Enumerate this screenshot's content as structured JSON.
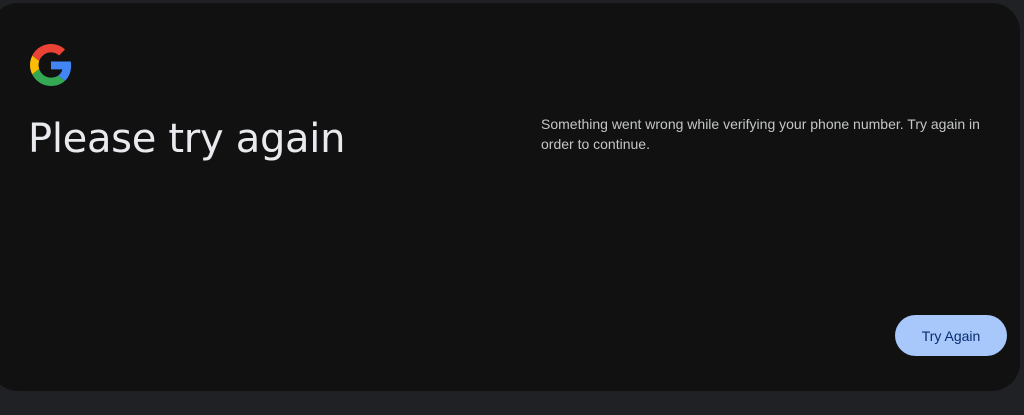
{
  "brand": {
    "logo_icon": "google-g-icon",
    "colors": {
      "blue": "#4285F4",
      "red": "#EA4335",
      "yellow": "#FBBC05",
      "green": "#34A853"
    }
  },
  "dialog": {
    "title": "Please try again",
    "message": "Something went wrong while verifying your phone number. Try again in order to continue.",
    "primary_button_label": "Try Again"
  },
  "theme": {
    "page_background": "#202124",
    "card_background": "#111112",
    "title_color": "#e8eaed",
    "text_color": "#c4c7c5",
    "button_background": "#a8c7fa",
    "button_text": "#062e6f"
  }
}
